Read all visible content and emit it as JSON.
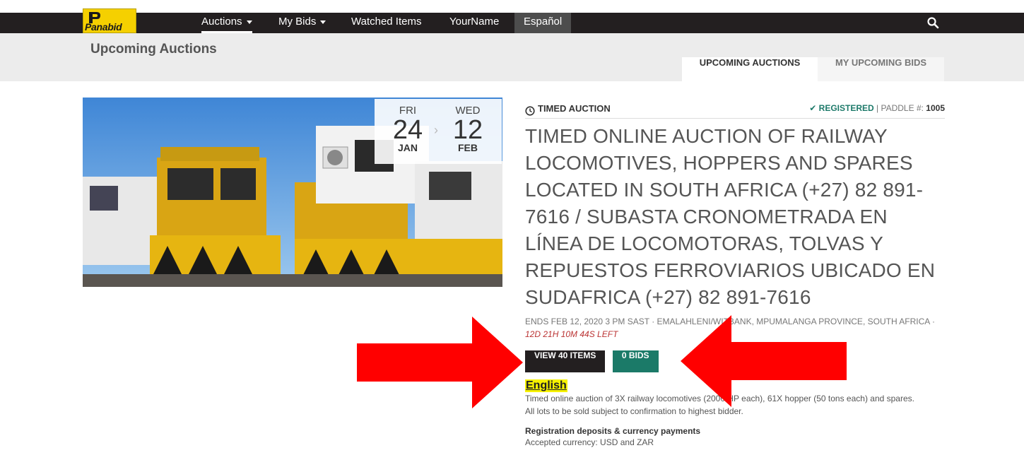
{
  "nav": {
    "logo_text": "Panabid",
    "items": [
      {
        "label": "Auctions",
        "dropdown": true
      },
      {
        "label": "My Bids",
        "dropdown": true
      },
      {
        "label": "Watched Items",
        "dropdown": false
      },
      {
        "label": "YourName",
        "dropdown": false
      },
      {
        "label": "Español",
        "dropdown": false
      }
    ],
    "search_icon": "search-icon"
  },
  "header": {
    "title": "Upcoming Auctions",
    "tabs": [
      {
        "label": "UPCOMING AUCTIONS",
        "active": true
      },
      {
        "label": "MY UPCOMING BIDS",
        "active": false
      }
    ]
  },
  "auction": {
    "start": {
      "dow": "FRI",
      "day": "24",
      "month": "JAN"
    },
    "end": {
      "dow": "WED",
      "day": "12",
      "month": "FEB"
    },
    "type_label": "TIMED AUCTION",
    "registered_label": "REGISTERED",
    "paddle_label": "PADDLE #:",
    "paddle_number": "1005",
    "title": "TIMED ONLINE AUCTION OF RAILWAY LOCOMOTIVES, HOPPERS AND SPARES LOCATED IN SOUTH AFRICA (+27) 82 891-7616 / SUBASTA CRONOMETRADA EN LÍNEA DE LOCOMOTORAS, TOLVAS Y REPUESTOS FERROVIARIOS UBICADO EN SUDAFRICA (+27) 82 891-7616",
    "ends": "ENDS FEB 12, 2020 3 PM SAST",
    "location": "EMALAHLENI/WITBANK, MPUMALANGA PROVINCE, SOUTH AFRICA",
    "time_left": "12D 21H 10M 44S LEFT",
    "view_items_label": "VIEW 40 ITEMS",
    "bids_label": "0 BIDS",
    "language_heading": "English",
    "description_1": "Timed online auction of 3X railway locomotives (2000 HP each), 61X hopper (50 tons each) and spares.",
    "description_2": "All lots to be sold subject to confirmation to highest bidder.",
    "deposits_heading": "Registration deposits & currency payments",
    "currency_line": "Accepted currency: USD and ZAR"
  },
  "colors": {
    "nav_bg": "#231f20",
    "accent_green": "#1b7a68",
    "logo_yellow": "#f5d000",
    "highlight_yellow": "#f7f200",
    "annotation_red": "#ff0000"
  }
}
